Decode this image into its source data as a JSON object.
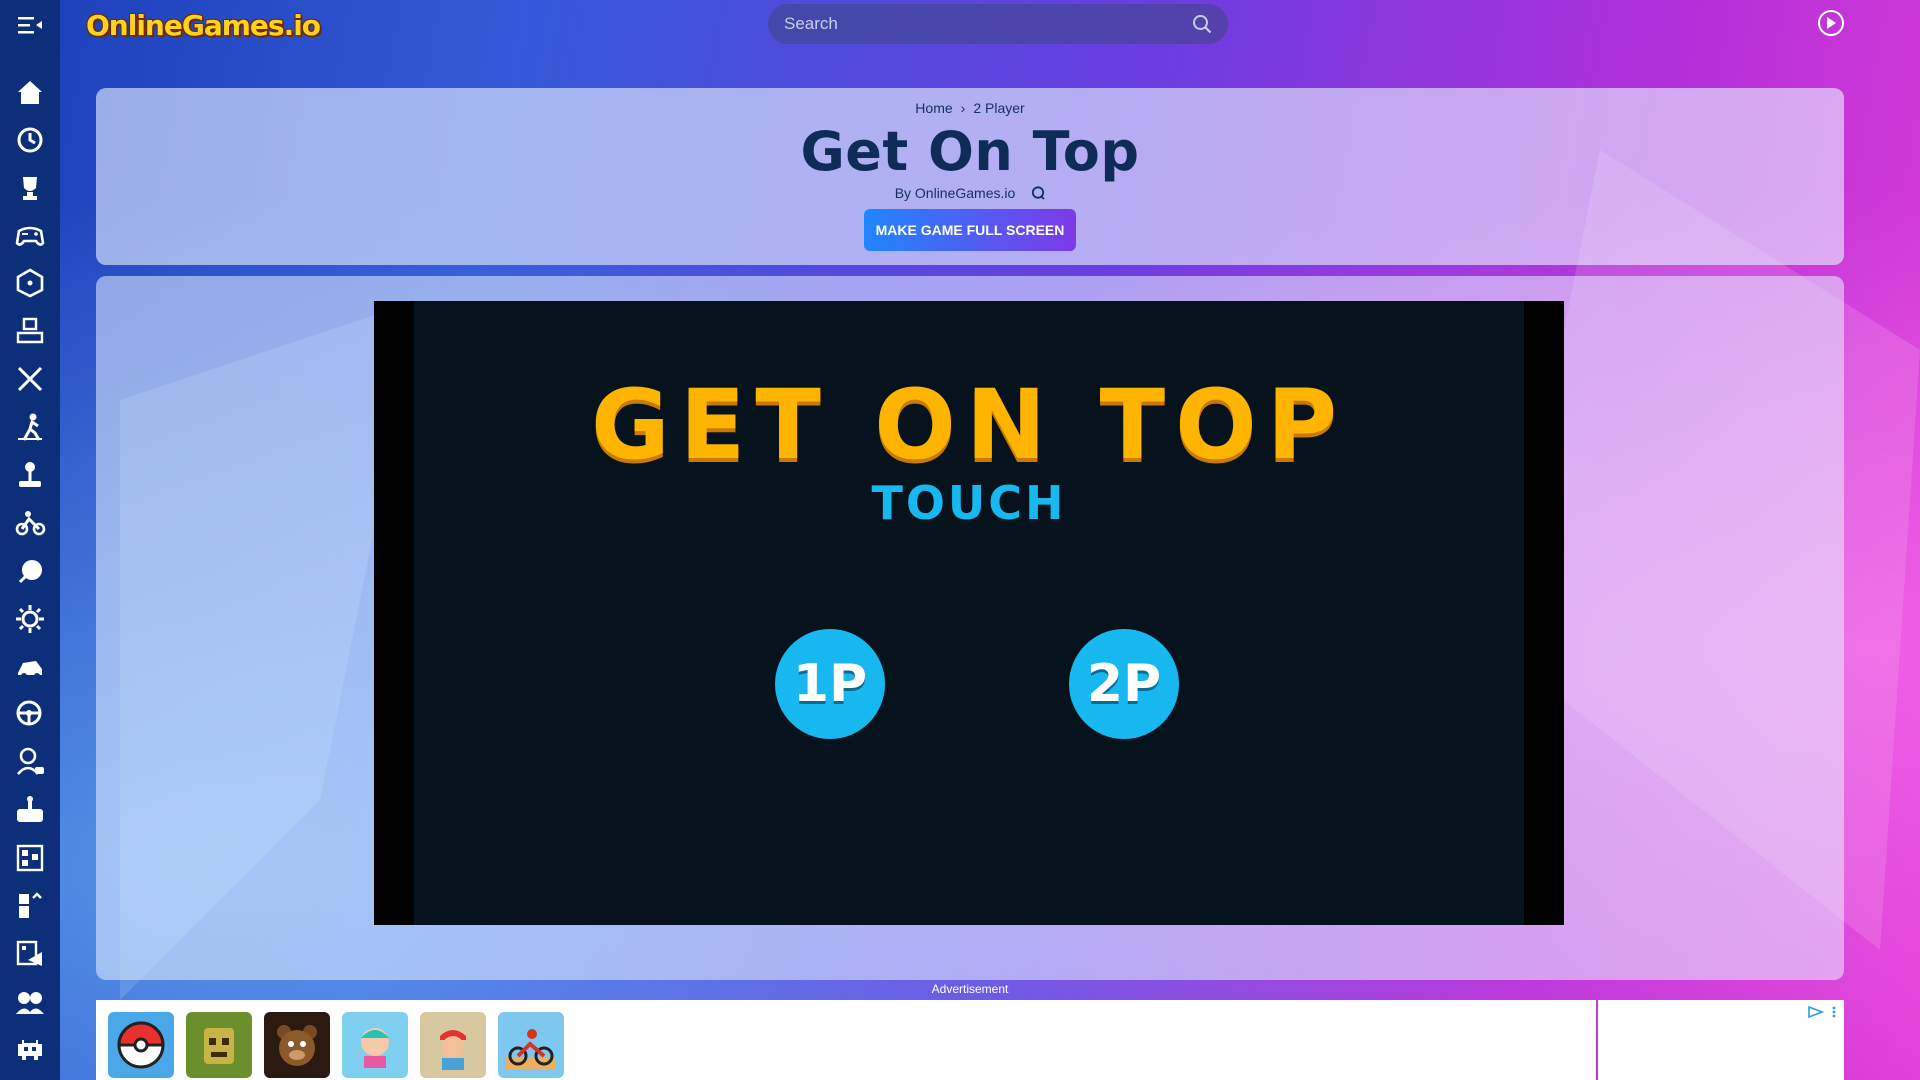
{
  "site": {
    "logo_text": "OnlineGames.io"
  },
  "search": {
    "placeholder": "Search"
  },
  "sidebar": {
    "items": [
      {
        "icon": "home-icon"
      },
      {
        "icon": "history-icon"
      },
      {
        "icon": "trophy-icon"
      },
      {
        "icon": "gamepad-icon"
      },
      {
        "icon": "dice-icon"
      },
      {
        "icon": "puzzle-controller-icon"
      },
      {
        "icon": "swords-icon"
      },
      {
        "icon": "runner-icon"
      },
      {
        "icon": "joystick-icon"
      },
      {
        "icon": "motorbike-icon"
      },
      {
        "icon": "ball-icon"
      },
      {
        "icon": "gear-icon"
      },
      {
        "icon": "racing-car-icon"
      },
      {
        "icon": "steering-wheel-icon"
      },
      {
        "icon": "character-icon"
      },
      {
        "icon": "arcade-controller-icon"
      },
      {
        "icon": "tetris-icon"
      },
      {
        "icon": "blocks-icon"
      },
      {
        "icon": "puzzle-board-icon"
      },
      {
        "icon": "multiplayer-icon"
      },
      {
        "icon": "space-invader-icon"
      }
    ]
  },
  "breadcrumb": {
    "home": "Home",
    "separator": "›",
    "category": "2 Player"
  },
  "page": {
    "title": "Get On Top",
    "byline": "By OnlineGames.io",
    "fullscreen_button": "MAKE GAME FULL SCREEN"
  },
  "game": {
    "title": "GET ON TOP",
    "subtitle": "TOUCH",
    "one_player": "1P",
    "two_player": "2P"
  },
  "ad": {
    "label": "Advertisement",
    "thumbnails": [
      "pokeball-game",
      "temple-run-game",
      "fnaf-game",
      "toca-game",
      "subway-surfers-game",
      "moto-x3m-game"
    ]
  },
  "colors": {
    "sidebar_bg": "#0d2f7a",
    "title_color": "#0f2c57",
    "game_title": "#ffb400",
    "game_accent": "#17b8ef"
  }
}
